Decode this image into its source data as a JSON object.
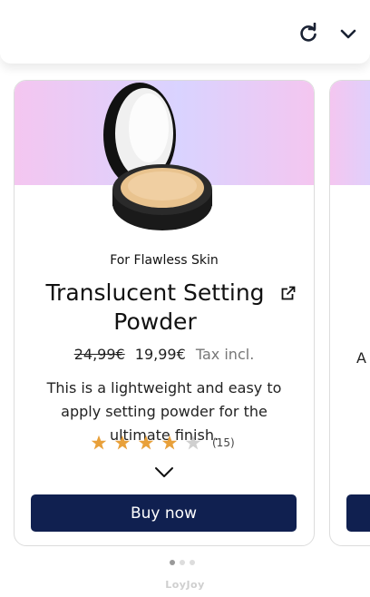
{
  "header": {
    "refresh_icon": "refresh-icon",
    "collapse_icon": "chevron-down-icon"
  },
  "product": {
    "tagline": "For Flawless Skin",
    "title": "Translucent Setting Powder",
    "external_link_icon": "external-link-icon",
    "old_price": "24,99€",
    "price": "19,99€",
    "tax_note": "Tax incl.",
    "description": "This is a lightweight and easy to apply setting powder for the ultimate finish.",
    "rating": 4,
    "rating_max": 5,
    "rating_count": "(15)",
    "expand_icon": "chevron-down-icon",
    "buy_label": "Buy now"
  },
  "next_card": {
    "peek_text": "A"
  },
  "carousel": {
    "total_slides": 3,
    "active_index": 0
  },
  "branding": {
    "text": "LoyJoy"
  },
  "colors": {
    "button_bg": "#102050",
    "star_filled": "#e8a03a",
    "star_empty": "#cfcfcf",
    "banner_gradient_start": "#f4c6f0",
    "banner_gradient_mid": "#d9d3ff"
  }
}
